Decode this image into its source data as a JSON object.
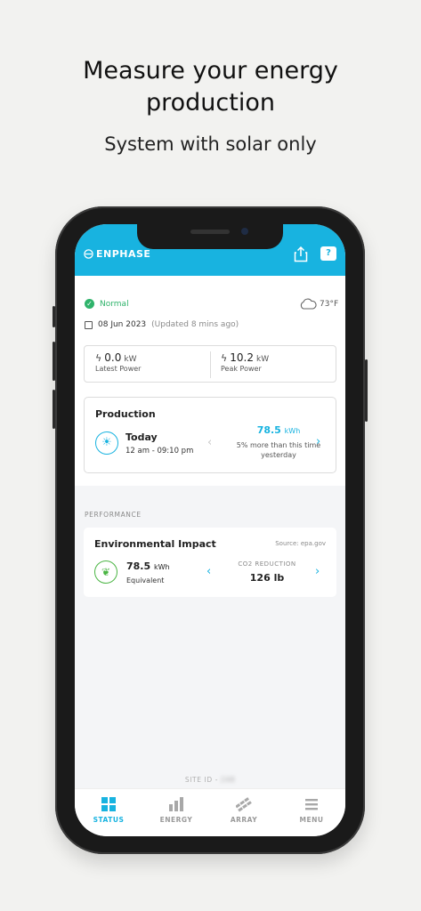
{
  "promo": {
    "headline_line1": "Measure your energy",
    "headline_line2": "production",
    "subhead": "System with solar only"
  },
  "app": {
    "brand": "ENPHASE",
    "accent_color": "#18b3e0",
    "status": {
      "text": "Normal",
      "color": "#2fb36b"
    },
    "weather": {
      "temp": "73°F",
      "icon": "cloud-icon"
    },
    "date": {
      "value": "08 Jun 2023",
      "updated": "(Updated 8 mins ago)"
    },
    "power": {
      "latest": {
        "value": "0.0",
        "unit": "kW",
        "label": "Latest Power"
      },
      "peak": {
        "value": "10.2",
        "unit": "kW",
        "label": "Peak Power"
      }
    },
    "production": {
      "title": "Production",
      "period": "Today",
      "range": "12 am - 09:10 pm",
      "value": "78.5",
      "unit": "kWh",
      "note": "5% more than this time yesterday"
    },
    "performance_label": "PERFORMANCE",
    "environmental": {
      "title": "Environmental Impact",
      "source": "Source: epa.gov",
      "value": "78.5",
      "unit": "kWh",
      "sub": "Equivalent",
      "co2_label": "CO2 REDUCTION",
      "co2_value": "126 lb"
    },
    "site_id_label": "SITE ID -",
    "site_id_value": "248",
    "tabs": [
      {
        "label": "STATUS",
        "icon": "status-grid-icon",
        "active": true
      },
      {
        "label": "ENERGY",
        "icon": "energy-bars-icon",
        "active": false
      },
      {
        "label": "ARRAY",
        "icon": "array-panels-icon",
        "active": false
      },
      {
        "label": "MENU",
        "icon": "menu-icon",
        "active": false
      }
    ]
  }
}
